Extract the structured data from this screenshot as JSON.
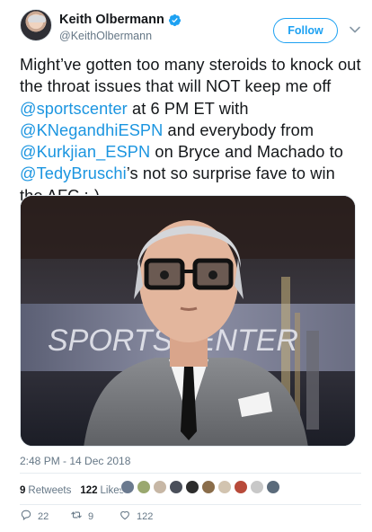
{
  "author": {
    "display_name": "Keith Olbermann",
    "handle": "@KeithOlbermann",
    "verified": true
  },
  "follow_button": {
    "label": "Follow"
  },
  "tweet": {
    "segments": [
      {
        "text": "Might’ve gotten too many steroids to knock out the throat issues that will NOT keep me off ",
        "mention": false
      },
      {
        "text": "@sportscenter",
        "mention": true
      },
      {
        "text": " at 6 PM ET with ",
        "mention": false
      },
      {
        "text": "@KNegandhiESPN",
        "mention": true
      },
      {
        "text": " and everybody from ",
        "mention": false
      },
      {
        "text": "@Kurkjian_ESPN",
        "mention": true
      },
      {
        "text": " on Bryce and Machado to ",
        "mention": false
      },
      {
        "text": "@TedyBruschi",
        "mention": true
      },
      {
        "text": "’s not so surprise fave to win the AFC ;-)",
        "mention": false
      }
    ]
  },
  "media": {
    "description_only": true,
    "backdrop_text": "SPORTSCENTER"
  },
  "timestamp": "2:48 PM - 14 Dec 2018",
  "stats": {
    "retweets_count": "9",
    "retweets_label": "Retweets",
    "likes_count": "122",
    "likes_label": "Likes"
  },
  "likers": [
    "#6b7a8f",
    "#9aa86f",
    "#c7b7a5",
    "#4a4f5a",
    "#2d2d2d",
    "#8a6d4a",
    "#d2c4b0",
    "#b84a3a",
    "#c8c8c8",
    "#5b6b7b"
  ],
  "actions": {
    "reply_count": "22",
    "retweet_count": "9",
    "like_count": "122"
  },
  "colors": {
    "accent": "#1da1f2",
    "mention": "#1b95e0",
    "muted": "#657786"
  }
}
